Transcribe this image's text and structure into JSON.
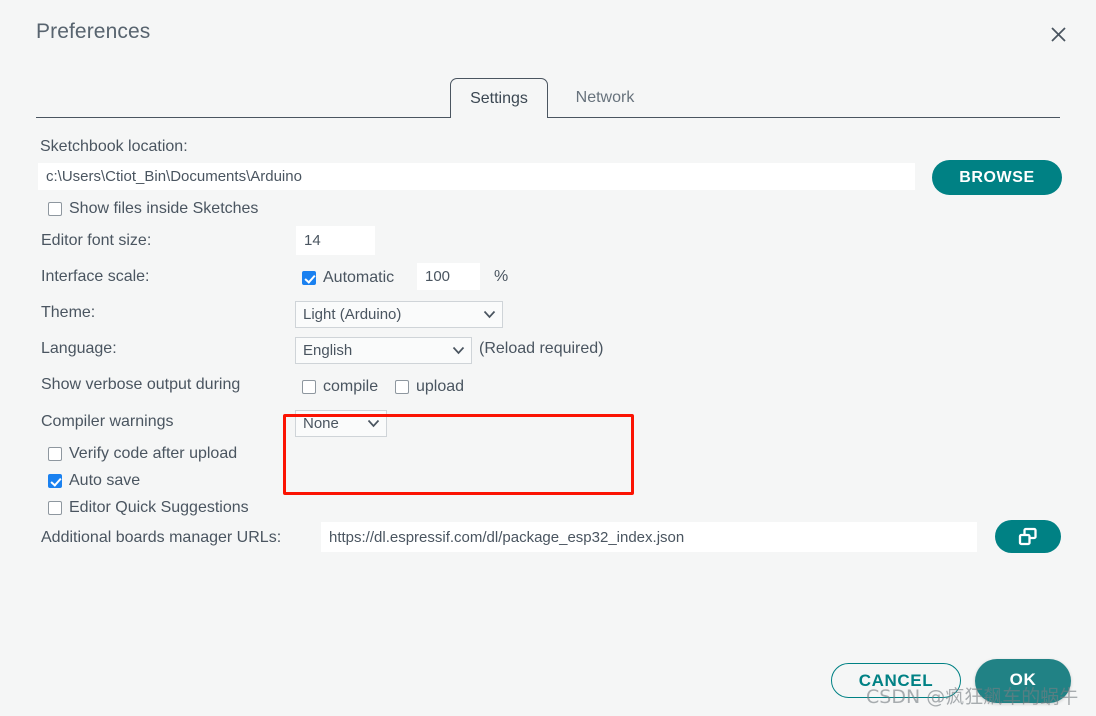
{
  "window": {
    "title": "Preferences",
    "close_icon": "close-icon"
  },
  "tabs": [
    {
      "label": "Settings",
      "active": true
    },
    {
      "label": "Network",
      "active": false
    }
  ],
  "settings": {
    "sketchbook": {
      "label": "Sketchbook location:",
      "value": "c:\\Users\\Ctiot_Bin\\Documents\\Arduino",
      "browse_label": "BROWSE"
    },
    "show_files_inside_sketches": {
      "label": "Show files inside Sketches",
      "checked": false
    },
    "editor_font_size": {
      "label": "Editor font size:",
      "value": "14"
    },
    "interface_scale": {
      "label": "Interface scale:",
      "automatic_label": "Automatic",
      "automatic_checked": true,
      "value": "100",
      "unit": "%"
    },
    "theme": {
      "label": "Theme:",
      "value": "Light (Arduino)"
    },
    "language": {
      "label": "Language:",
      "value": "English",
      "note": "(Reload required)"
    },
    "verbose_output": {
      "label": "Show verbose output during",
      "compile_label": "compile",
      "compile_checked": false,
      "upload_label": "upload",
      "upload_checked": false
    },
    "compiler_warnings": {
      "label": "Compiler warnings",
      "value": "None"
    },
    "verify_code_after_upload": {
      "label": "Verify code after upload",
      "checked": false
    },
    "auto_save": {
      "label": "Auto save",
      "checked": true
    },
    "editor_quick_suggestions": {
      "label": "Editor Quick Suggestions",
      "checked": false
    },
    "boards_manager_urls": {
      "label": "Additional boards manager URLs:",
      "value": "https://dl.espressif.com/dl/package_esp32_index.json",
      "button_icon": "open-window-icon"
    }
  },
  "footer": {
    "cancel_label": "CANCEL",
    "ok_label": "OK"
  },
  "annotation": {
    "highlight": "red-rectangle-theme-language"
  },
  "watermark": {
    "text": "CSDN @疯狂飙车的蜗牛"
  },
  "colors": {
    "accent_teal": "#008184",
    "checkbox_blue": "#1a81f0",
    "highlight_red": "#fb1302",
    "background": "#f5f6f6",
    "text": "#4a5560"
  }
}
